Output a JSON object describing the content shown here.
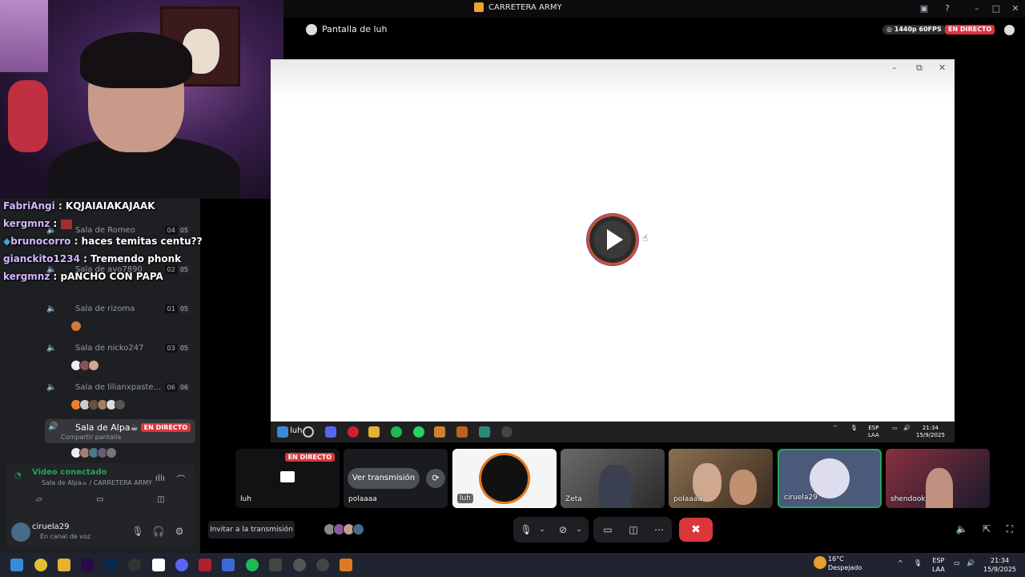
{
  "window": {
    "title": "CARRETERA ARMY"
  },
  "header": {
    "title": "Pantalla de luh",
    "quality": "◎ 1440p 60FPS",
    "live": "EN DIRECTO"
  },
  "chat": [
    {
      "user": "FabriAngi",
      "message": ": KQJAIAIAKAJAAK"
    },
    {
      "user": "kergmnz",
      "message": ":"
    },
    {
      "user": "brunocorro",
      "message": ": haces temitas centu??"
    },
    {
      "user": "gianckito1234",
      "message": ": Tremendo phonk"
    },
    {
      "user": "kergmnz",
      "message": ": pANCHO CON PAPA"
    }
  ],
  "channels": [
    {
      "name": "Sala de Romeo",
      "count": [
        "04",
        "05"
      ]
    },
    {
      "name": "Sala de avo7890",
      "count": [
        "02",
        "05"
      ]
    },
    {
      "name": "Sala de rizoma",
      "count": [
        "01",
        "05"
      ]
    },
    {
      "name": "Sala de nicko247",
      "count": [
        "03",
        "05"
      ]
    },
    {
      "name": "Sala de lilianxpaste...",
      "count": [
        "06",
        "06"
      ]
    }
  ],
  "active_channel": {
    "name": "Sala de Alpa☕",
    "sub": "Compartir pantalla",
    "live": "EN DIRECTO"
  },
  "voice": {
    "status": "Video conectado",
    "location": "Sala de Alpa☕ / CARRETERA ARMY"
  },
  "user": {
    "name": "ciruela29",
    "status": "En canal de voz"
  },
  "stream": {
    "taskbar_label": "luh",
    "tray_lang": [
      "ESP",
      "LAA"
    ],
    "tray_time": [
      "21:34",
      "15/9/2025"
    ]
  },
  "tiles": [
    {
      "name": "luh",
      "live": "EN DIRECTO"
    },
    {
      "name": "polaaaa",
      "button": "Ver transmisión"
    },
    {
      "name": "luh"
    },
    {
      "name": "Zeta"
    },
    {
      "name": "polaaaa"
    },
    {
      "name": "ciruela29"
    },
    {
      "name": "shendook"
    }
  ],
  "controls": {
    "invite": "Invitar a la transmisión"
  },
  "taskbar": {
    "weather_temp": "16°C",
    "weather_desc": "Despejado",
    "lang": [
      "ESP",
      "LAA"
    ],
    "time": "21:34",
    "date": "15/9/2025"
  },
  "colors": {
    "live": "#da373c",
    "connected": "#23a55a",
    "sidebar": "#1e1f22"
  }
}
